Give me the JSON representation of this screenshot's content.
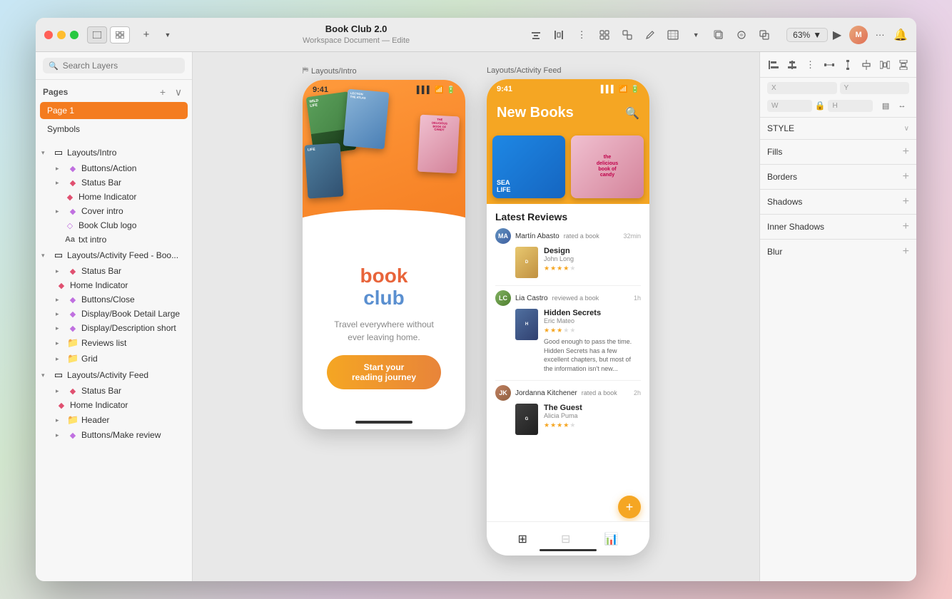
{
  "window": {
    "title": "Book Club 2.0",
    "subtitle": "Workspace Document — Edite"
  },
  "toolbar": {
    "zoom": "63%",
    "add_btn": "+",
    "play_icon": "▶"
  },
  "sidebar": {
    "search_placeholder": "Search Layers",
    "pages_label": "Pages",
    "page1_label": "Page 1",
    "symbols_label": "Symbols",
    "layers": [
      {
        "id": "layouts-intro",
        "label": "Layouts/Intro",
        "type": "group",
        "expanded": true
      },
      {
        "id": "buttons-action",
        "label": "Buttons/Action",
        "type": "child"
      },
      {
        "id": "status-bar-1",
        "label": "Status Bar",
        "type": "child"
      },
      {
        "id": "home-indicator-1",
        "label": "Home Indicator",
        "type": "deep"
      },
      {
        "id": "cover-intro",
        "label": "Cover intro",
        "type": "child"
      },
      {
        "id": "book-club-logo",
        "label": "Book Club logo",
        "type": "deep"
      },
      {
        "id": "txt-intro",
        "label": "txt intro",
        "type": "deep"
      },
      {
        "id": "layouts-activity-feed-boo",
        "label": "Layouts/Activity Feed - Boo...",
        "type": "group",
        "expanded": true
      },
      {
        "id": "status-bar-2",
        "label": "Status Bar",
        "type": "child"
      },
      {
        "id": "home-indicator-2",
        "label": "Home Indicator",
        "type": "child"
      },
      {
        "id": "buttons-close",
        "label": "Buttons/Close",
        "type": "child"
      },
      {
        "id": "display-book-detail",
        "label": "Display/Book Detail Large",
        "type": "child"
      },
      {
        "id": "display-description",
        "label": "Display/Description short",
        "type": "child"
      },
      {
        "id": "reviews-list",
        "label": "Reviews list",
        "type": "child"
      },
      {
        "id": "grid",
        "label": "Grid",
        "type": "child"
      },
      {
        "id": "layouts-activity-feed",
        "label": "Layouts/Activity Feed",
        "type": "group",
        "expanded": true
      },
      {
        "id": "status-bar-3",
        "label": "Status Bar",
        "type": "child"
      },
      {
        "id": "home-indicator-3",
        "label": "Home Indicator",
        "type": "child"
      },
      {
        "id": "header",
        "label": "Header",
        "type": "child"
      },
      {
        "id": "buttons-make-review",
        "label": "Buttons/Make review",
        "type": "child"
      }
    ]
  },
  "canvas": {
    "frame1_label": "Layouts/Intro",
    "frame2_label": "Layouts/Activity Feed",
    "intro_time": "9:41",
    "activity_time": "9:41",
    "intro_tagline_line1": "Travel everywhere without",
    "intro_tagline_line2": "ever leaving home.",
    "start_btn_label": "Start your reading journey",
    "activity_title": "New Books",
    "latest_reviews_title": "Latest Reviews",
    "reviews": [
      {
        "reviewer": "Martín Abasto",
        "action": "rated a book",
        "time": "32min",
        "book_title": "Design",
        "book_author": "John Long",
        "stars": 4,
        "text": ""
      },
      {
        "reviewer": "Lia Castro",
        "action": "reviewed a book",
        "time": "1h",
        "book_title": "Hidden Secrets",
        "book_author": "Eric Mateo",
        "stars": 3,
        "text": "Good enough to pass the time. Hidden Secrets has a few excellent chapters, but most of the information isn't new..."
      },
      {
        "reviewer": "Jordanna Kitchener",
        "action": "rated a book",
        "time": "2h",
        "book_title": "The Guest",
        "book_author": "Alicia Puma",
        "stars": 4,
        "text": ""
      }
    ]
  },
  "inspector": {
    "style_label": "STYLE",
    "fills_label": "Fills",
    "borders_label": "Borders",
    "shadows_label": "Shadows",
    "inner_shadows_label": "Inner Shadows",
    "blur_label": "Blur",
    "x_label": "X",
    "y_label": "Y",
    "w_label": "W",
    "h_label": "H"
  }
}
